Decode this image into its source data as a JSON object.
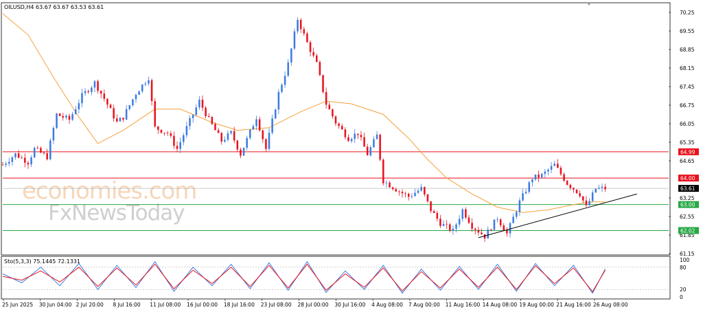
{
  "chart_data": [
    {
      "type": "candlestick",
      "title": "OILUSD,H4  63.67 63.67 63.53 63.61",
      "y_ticks": [
        "70.25",
        "69.55",
        "68.85",
        "68.15",
        "67.45",
        "66.75",
        "66.05",
        "65.35",
        "64.65",
        "63.25",
        "62.55",
        "61.85",
        "61.15"
      ],
      "ylim": [
        61.15,
        70.25
      ],
      "x_ticks": [
        "25 Jun 2025",
        "30 Jun 04:00",
        "2 Jul 20:00",
        "8 Jul 16:00",
        "11 Jul 08:00",
        "16 Jul 00:00",
        "18 Jul 16:00",
        "23 Jul 08:00",
        "28 Jul 00:00",
        "30 Jul 16:00",
        "4 Aug 08:00",
        "7 Aug 00:00",
        "11 Aug 16:00",
        "14 Aug 08:00",
        "19 Aug 00:00",
        "21 Aug 16:00",
        "26 Aug 08:00"
      ],
      "horizontal_levels": [
        {
          "value": 64.99,
          "label": "64.99",
          "color": "#e8121d"
        },
        {
          "value": 64.0,
          "label": "64.00",
          "color": "#e8121d"
        },
        {
          "value": 63.0,
          "label": "63.00",
          "color": "#27a844"
        },
        {
          "value": 62.02,
          "label": "62.02",
          "color": "#27a844"
        }
      ],
      "current_price": {
        "value": 63.61,
        "label": "63.61"
      },
      "close_path": [
        [
          0,
          64.5
        ],
        [
          4,
          64.9
        ],
        [
          8,
          64.6
        ],
        [
          10,
          65.1
        ],
        [
          14,
          64.8
        ],
        [
          17,
          66.4
        ],
        [
          21,
          66.2
        ],
        [
          25,
          67.1
        ],
        [
          29,
          67.6
        ],
        [
          32,
          67.0
        ],
        [
          36,
          66.1
        ],
        [
          38,
          66.3
        ],
        [
          42,
          67.2
        ],
        [
          46,
          67.8
        ],
        [
          48,
          65.9
        ],
        [
          52,
          65.7
        ],
        [
          55,
          65.1
        ],
        [
          58,
          65.9
        ],
        [
          62,
          66.9
        ],
        [
          65,
          66.2
        ],
        [
          69,
          65.4
        ],
        [
          72,
          65.7
        ],
        [
          75,
          64.9
        ],
        [
          80,
          66.3
        ],
        [
          83,
          65.1
        ],
        [
          87,
          67.2
        ],
        [
          90,
          68.3
        ],
        [
          93,
          70.0
        ],
        [
          96,
          69.1
        ],
        [
          99,
          68.3
        ],
        [
          102,
          66.8
        ],
        [
          105,
          66.1
        ],
        [
          109,
          65.5
        ],
        [
          112,
          65.7
        ],
        [
          115,
          64.9
        ],
        [
          118,
          65.6
        ],
        [
          120,
          63.9
        ],
        [
          125,
          63.5
        ],
        [
          128,
          63.3
        ],
        [
          132,
          63.6
        ],
        [
          135,
          62.8
        ],
        [
          138,
          62.3
        ],
        [
          142,
          62.0
        ],
        [
          145,
          62.8
        ],
        [
          148,
          62.2
        ],
        [
          152,
          61.8
        ],
        [
          156,
          62.5
        ],
        [
          159,
          61.9
        ],
        [
          163,
          63.1
        ],
        [
          167,
          64.0
        ],
        [
          170,
          64.1
        ],
        [
          174,
          64.5
        ],
        [
          178,
          63.8
        ],
        [
          182,
          63.4
        ],
        [
          184,
          62.9
        ],
        [
          187,
          63.6
        ],
        [
          190,
          63.61
        ]
      ],
      "indicators": [
        {
          "name": "",
          "type": "moving-average",
          "color": "#f5a03a",
          "values": [
            [
              0,
              70.2
            ],
            [
              8,
              69.4
            ],
            [
              16,
              67.8
            ],
            [
              24,
              66.3
            ],
            [
              30,
              65.3
            ],
            [
              38,
              65.8
            ],
            [
              48,
              66.6
            ],
            [
              56,
              66.6
            ],
            [
              66,
              66.1
            ],
            [
              74,
              65.8
            ],
            [
              84,
              65.9
            ],
            [
              94,
              66.5
            ],
            [
              102,
              66.9
            ],
            [
              110,
              66.8
            ],
            [
              120,
              66.4
            ],
            [
              128,
              65.5
            ],
            [
              134,
              64.7
            ],
            [
              140,
              64.0
            ],
            [
              148,
              63.4
            ],
            [
              156,
              62.9
            ],
            [
              164,
              62.7
            ],
            [
              172,
              62.8
            ],
            [
              180,
              63.0
            ],
            [
              186,
              63.1
            ],
            [
              190,
              63.1
            ]
          ]
        }
      ],
      "annotations": [
        {
          "type": "trendline",
          "color": "#000000",
          "from": [
            150,
            61.75
          ],
          "to": [
            200,
            63.4
          ]
        }
      ]
    },
    {
      "type": "line",
      "title": "Sto(5,3,3) 75.1445 72.1331",
      "y_ticks": [
        "100",
        "80",
        "20",
        "0"
      ],
      "ylim": [
        0,
        100
      ],
      "levels": [
        80,
        20
      ],
      "series": [
        {
          "name": "",
          "color": "#3d7be0",
          "values": [
            [
              0,
              62
            ],
            [
              6,
              38
            ],
            [
              12,
              80
            ],
            [
              18,
              30
            ],
            [
              24,
              90
            ],
            [
              30,
              20
            ],
            [
              36,
              85
            ],
            [
              42,
              25
            ],
            [
              48,
              95
            ],
            [
              54,
              15
            ],
            [
              60,
              80
            ],
            [
              66,
              30
            ],
            [
              72,
              88
            ],
            [
              78,
              22
            ],
            [
              84,
              92
            ],
            [
              90,
              18
            ],
            [
              96,
              95
            ],
            [
              102,
              12
            ],
            [
              108,
              70
            ],
            [
              114,
              20
            ],
            [
              120,
              85
            ],
            [
              126,
              10
            ],
            [
              132,
              75
            ],
            [
              138,
              18
            ],
            [
              144,
              82
            ],
            [
              150,
              20
            ],
            [
              156,
              88
            ],
            [
              162,
              15
            ],
            [
              168,
              90
            ],
            [
              174,
              30
            ],
            [
              180,
              85
            ],
            [
              186,
              10
            ],
            [
              190,
              75
            ]
          ]
        },
        {
          "name": "",
          "color": "#e8121d",
          "values": [
            [
              0,
              55
            ],
            [
              6,
              45
            ],
            [
              12,
              70
            ],
            [
              18,
              40
            ],
            [
              24,
              80
            ],
            [
              30,
              28
            ],
            [
              36,
              78
            ],
            [
              42,
              32
            ],
            [
              48,
              88
            ],
            [
              54,
              22
            ],
            [
              60,
              72
            ],
            [
              66,
              36
            ],
            [
              72,
              80
            ],
            [
              78,
              28
            ],
            [
              84,
              85
            ],
            [
              90,
              24
            ],
            [
              96,
              88
            ],
            [
              102,
              18
            ],
            [
              108,
              62
            ],
            [
              114,
              26
            ],
            [
              120,
              78
            ],
            [
              126,
              16
            ],
            [
              132,
              68
            ],
            [
              138,
              24
            ],
            [
              144,
              75
            ],
            [
              150,
              26
            ],
            [
              156,
              80
            ],
            [
              162,
              20
            ],
            [
              168,
              84
            ],
            [
              174,
              36
            ],
            [
              180,
              78
            ],
            [
              186,
              14
            ],
            [
              190,
              72
            ]
          ]
        }
      ]
    }
  ],
  "watermark": {
    "line1": "economies.com",
    "line2": "FxNewsToday"
  }
}
